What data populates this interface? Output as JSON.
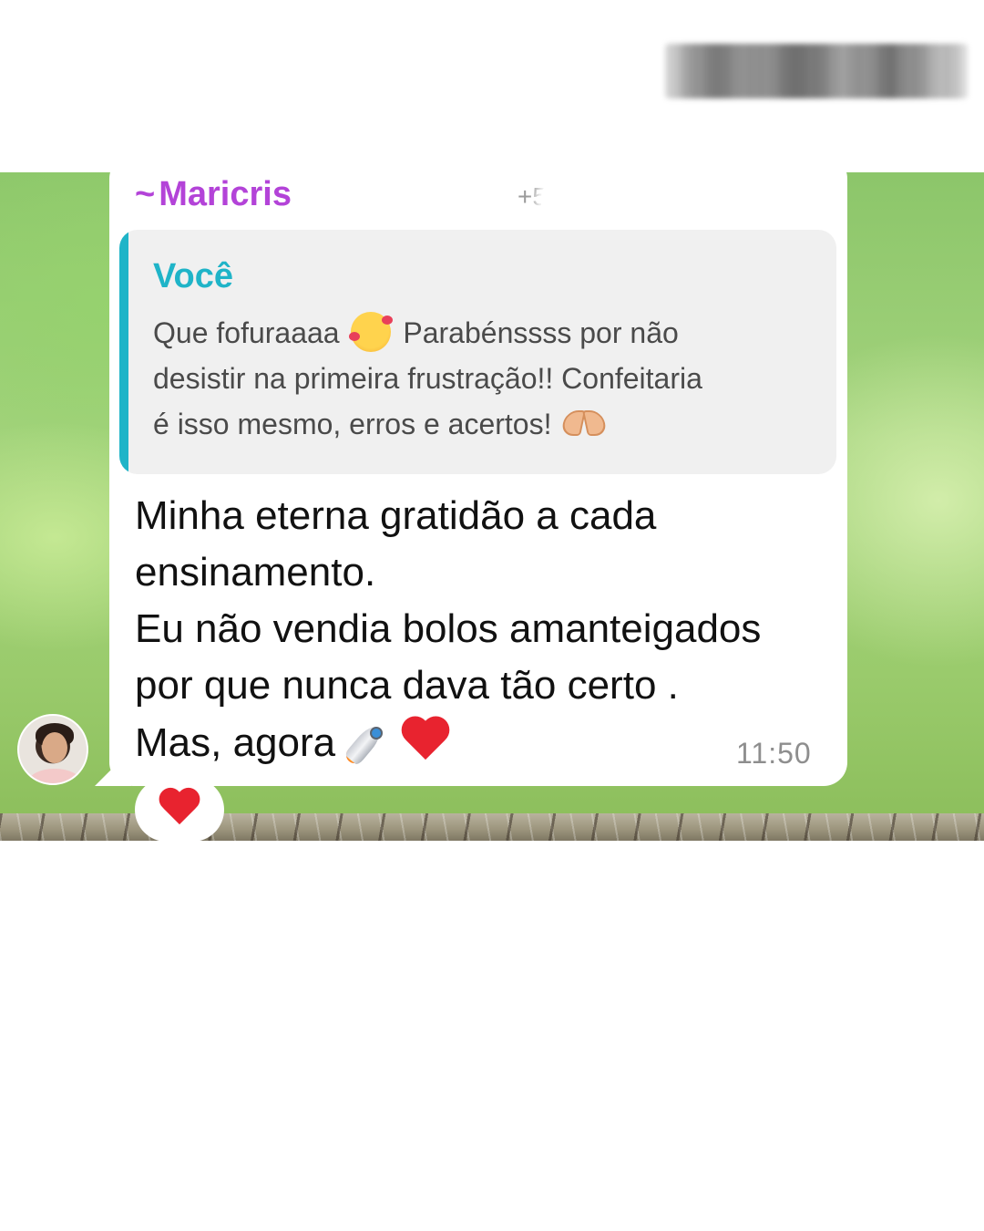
{
  "header": {
    "redacted_label": ""
  },
  "message": {
    "sender_prefix": "~",
    "sender_name": "Maricris",
    "sender_phone": "+5",
    "sender_color": "#b343d8",
    "quote": {
      "author": "Você",
      "author_color": "#1fb4c8",
      "text_part1": "Que fofuraaaa",
      "emoji1": "smiling-face-with-hearts",
      "text_part2": "Parabénssss por não",
      "line2": "desistir na primeira frustração!! Confeitaria",
      "line3": "é isso mesmo, erros e acertos!",
      "emoji2": "heart-hands"
    },
    "lines": [
      "Minha eterna gratidão a cada",
      "ensinamento.",
      "Eu não vendia bolos amanteigados",
      "por que nunca dava tão certo .",
      "Mas, agora"
    ],
    "trailing_emojis": [
      "rocket",
      "red-heart"
    ],
    "time": "11:50",
    "reaction": "red-heart"
  }
}
